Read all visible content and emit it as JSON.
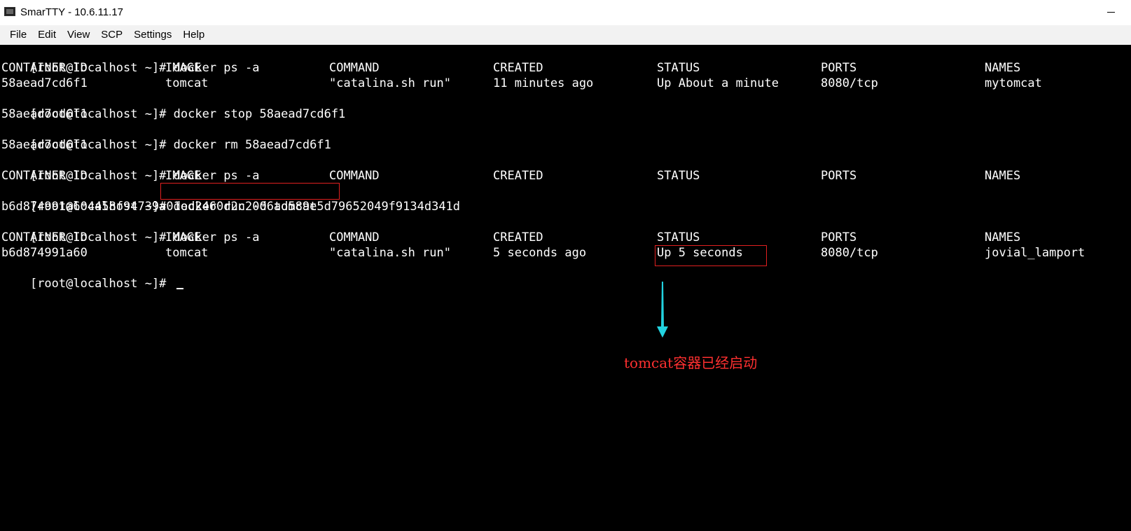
{
  "window": {
    "title": "SmarTTY - 10.6.11.17",
    "icon": "terminal-icon",
    "minimize_icon": "minimize-icon"
  },
  "menu": [
    "File",
    "Edit",
    "View",
    "SCP",
    "Settings",
    "Help"
  ],
  "terminal": {
    "prompt": "[root@localhost ~]# ",
    "commands": {
      "ps1": "docker ps -a",
      "stop": "docker stop 58aead7cd6f1",
      "rm": "docker rm 58aead7cd6f1",
      "ps2": "docker ps -a",
      "run": "docker run -d tomcat",
      "ps3": "docker ps -a"
    },
    "outputs": {
      "stop_result": "58aead7cd6f1",
      "rm_result": "58aead7cd6f1",
      "run_result": "b6d874991a604458f94739a01ed2460d2c2006ad589e5d79652049f9134d341d"
    },
    "headers": [
      "CONTAINER ID",
      "IMAGE",
      "COMMAND",
      "CREATED",
      "STATUS",
      "PORTS",
      "NAMES"
    ],
    "table1_row": [
      "58aead7cd6f1",
      "tomcat",
      "\"catalina.sh run\"",
      "11 minutes ago",
      "Up About a minute",
      "8080/tcp",
      "mytomcat"
    ],
    "table3_row": [
      "b6d874991a60",
      "tomcat",
      "\"catalina.sh run\"",
      "5 seconds ago",
      "Up 5 seconds",
      "8080/tcp",
      "jovial_lamport"
    ]
  },
  "annotation": {
    "text": "tomcat容器已经启动",
    "text_color": "#ff3030",
    "box_color": "#e02020",
    "arrow_color": "#22d3e0"
  }
}
